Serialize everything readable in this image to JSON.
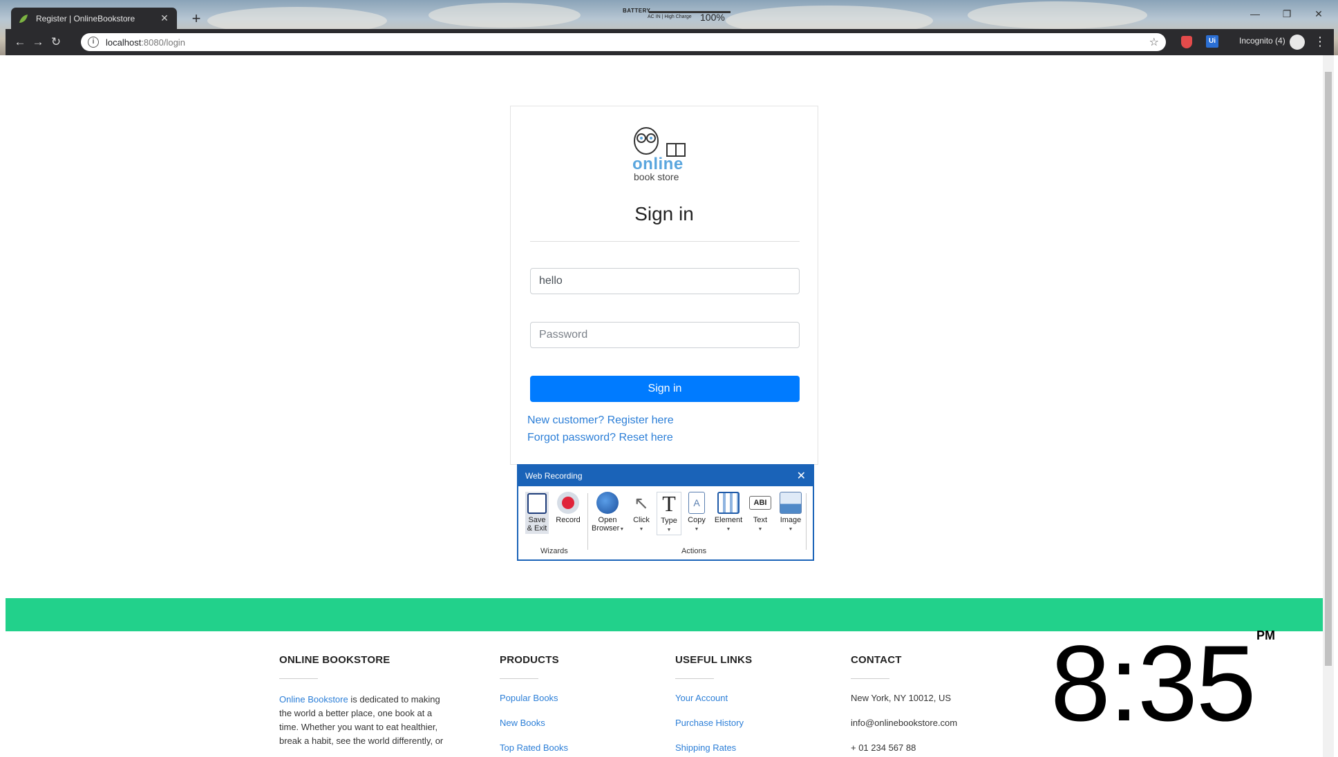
{
  "browser": {
    "tab_title": "Register | OnlineBookstore",
    "tab_close": "✕",
    "new_tab": "+",
    "url_host": "localhost",
    "url_path": ":8080/login",
    "incognito_label": "Incognito (4)",
    "menu_dots": "⋮",
    "ext_ui_label": "Ui",
    "back": "←",
    "forward": "→",
    "reload": "↻",
    "star": "☆",
    "info": "i",
    "window_minimize": "—",
    "window_restore": "❐",
    "window_close": "✕"
  },
  "battery": {
    "label": "BATTERY",
    "status": "AC IN | High Charge",
    "percent": "100%"
  },
  "logo": {
    "line1": "online",
    "line2": "book store"
  },
  "login": {
    "title": "Sign in",
    "username_value": "hello",
    "password_placeholder": "Password",
    "submit_label": "Sign in",
    "register_link": "New customer? Register here",
    "forgot_link": "Forgot password? Reset here"
  },
  "recorder": {
    "title": "Web Recording",
    "close": "✕",
    "tools": {
      "save": "Save\n& Exit",
      "record": "Record",
      "open_browser": "Open\nBrowser",
      "click": "Click",
      "type": "Type",
      "copy": "Copy",
      "element": "Element",
      "text": "Text",
      "image": "Image"
    },
    "groups": {
      "wizards": "Wizards",
      "actions": "Actions"
    }
  },
  "footer": {
    "about_heading": "ONLINE BOOKSTORE",
    "about_link": "Online Bookstore",
    "about_text": " is dedicated to making the world a better place, one book at a time. Whether you want to eat healthier, break a habit, see the world differently, or",
    "products_heading": "PRODUCTS",
    "products": [
      "Popular Books",
      "New Books",
      "Top Rated Books"
    ],
    "links_heading": "USEFUL LINKS",
    "links": [
      "Your Account",
      "Purchase History",
      "Shipping Rates"
    ],
    "contact_heading": "CONTACT",
    "contact": [
      "New York, NY 10012, US",
      "info@onlinebookstore.com",
      "+ 01 234 567 88"
    ]
  },
  "clock": {
    "time": "8:35",
    "ampm": "PM"
  },
  "colors": {
    "brand_blue": "#007bff",
    "link": "#2b7ed7",
    "band_green": "#22d18b",
    "recorder_blue": "#1a63b8"
  }
}
